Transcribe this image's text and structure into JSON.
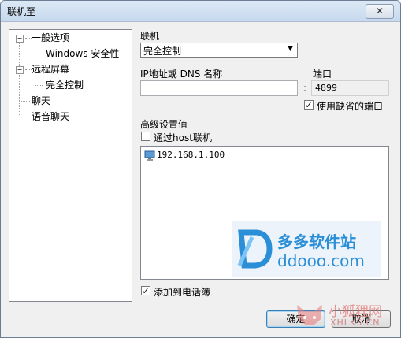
{
  "window": {
    "title": "联机至",
    "close_glyph": "✕"
  },
  "tree": {
    "items": [
      {
        "label": "一般选项"
      },
      {
        "label": "Windows 安全性"
      },
      {
        "label": "远程屏幕"
      },
      {
        "label": "完全控制"
      },
      {
        "label": "聊天"
      },
      {
        "label": "语音聊天"
      }
    ],
    "collapse_glyph": "−"
  },
  "connection": {
    "label": "联机",
    "selected": "完全控制",
    "arrow": "▼"
  },
  "address": {
    "label": "IP地址或 DNS 名称",
    "value": "",
    "separator": ":"
  },
  "port": {
    "label": "端口",
    "value": "4899",
    "use_default_label": "使用缺省的端口",
    "use_default_checked": true
  },
  "advanced": {
    "label": "高级设置值",
    "via_host_label": "通过host联机",
    "via_host_checked": false,
    "hosts": [
      {
        "ip": "192.168.1.100"
      }
    ]
  },
  "phonebook": {
    "label": "添加到电话簿",
    "checked": true
  },
  "buttons": {
    "ok": "确定",
    "cancel": "取消"
  },
  "watermark": {
    "brand": "多多软件站",
    "url": "ddooo.com",
    "site": "XHLKS.CN",
    "fox_text": "小狐狸网"
  },
  "colors": {
    "accent": "#3c7fb1",
    "watermark_blue": "#2b8fd8"
  }
}
